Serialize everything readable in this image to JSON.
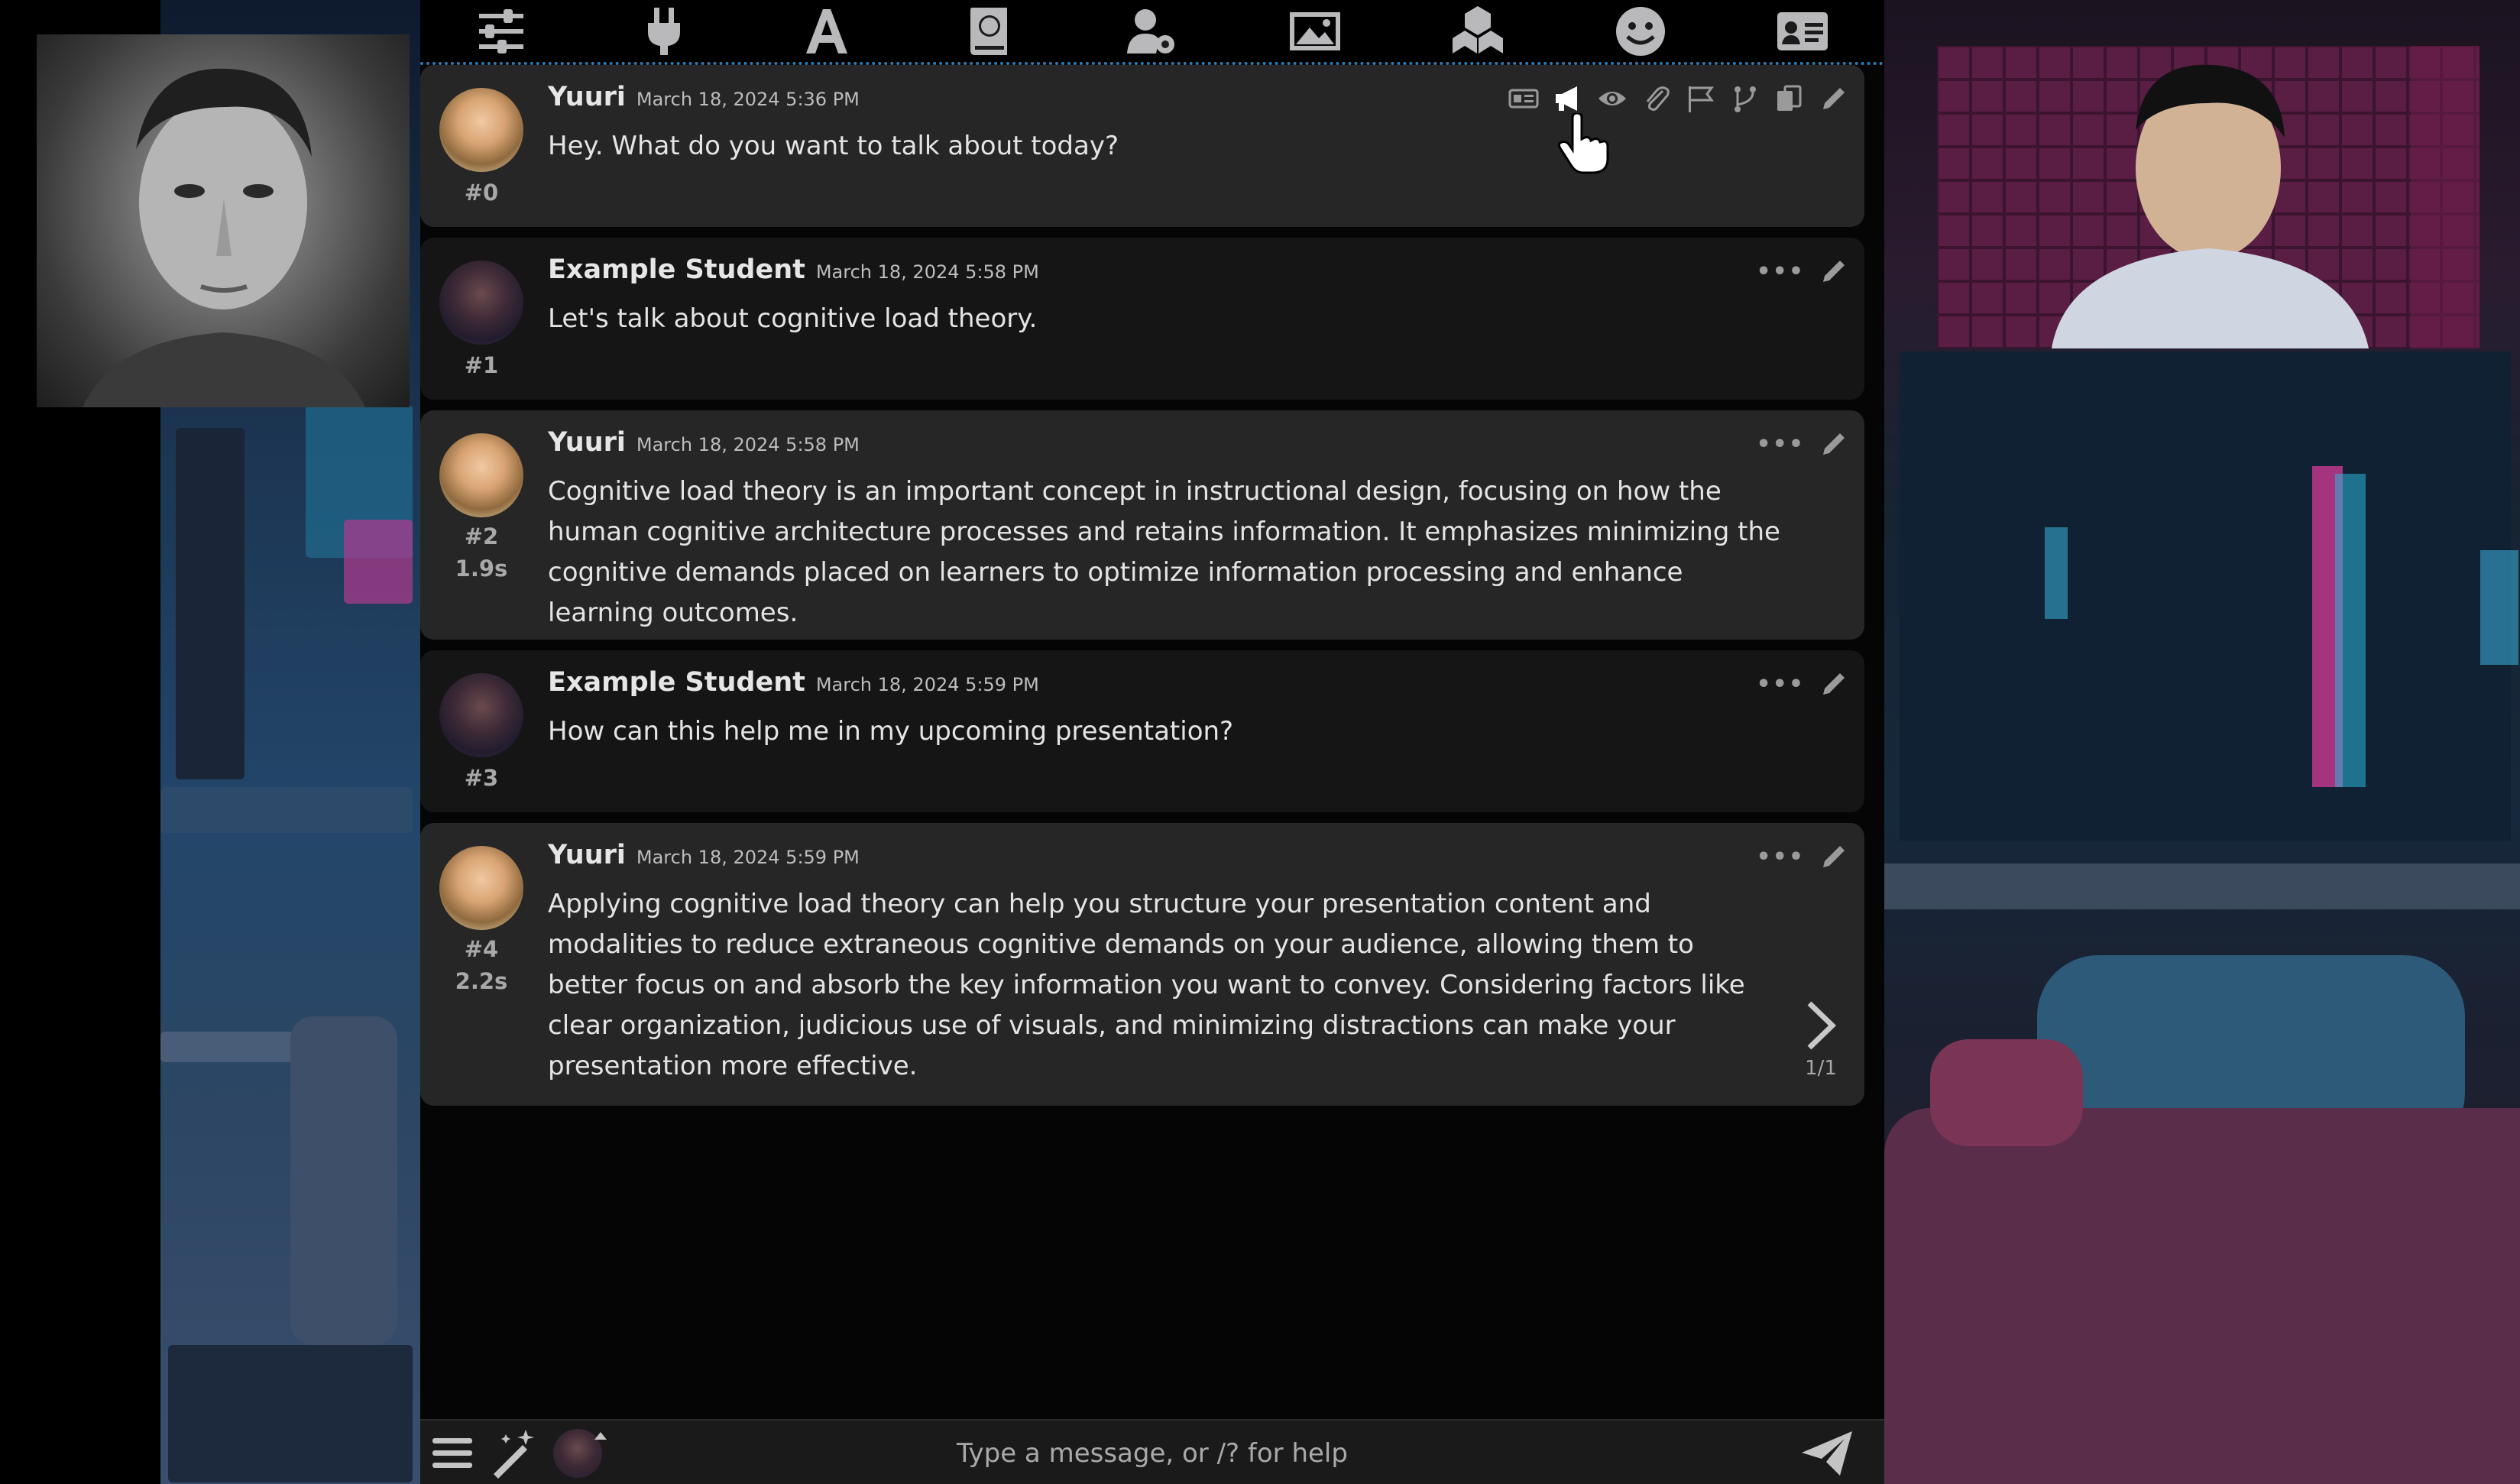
{
  "window": {
    "top_toolbar": [
      {
        "icon": "sliders-icon"
      },
      {
        "icon": "plug-icon"
      },
      {
        "icon": "font-a-icon"
      },
      {
        "icon": "book-globe-icon"
      },
      {
        "icon": "user-gear-icon"
      },
      {
        "icon": "image-icon"
      },
      {
        "icon": "cubes-icon"
      },
      {
        "icon": "smiley-icon"
      },
      {
        "icon": "id-card-icon"
      }
    ]
  },
  "messages": [
    {
      "id": "#0",
      "name": "Yuuri",
      "time": "March 18, 2024 5:36 PM",
      "text": "Hey. What do you want to talk about today?",
      "role": "char"
    },
    {
      "id": "#1",
      "name": "Example Student",
      "time": "March 18, 2024 5:58 PM",
      "text": "Let's talk about cognitive load theory.",
      "role": "user"
    },
    {
      "id": "#2",
      "timer": "1.9s",
      "name": "Yuuri",
      "time": "March 18, 2024 5:58 PM",
      "text": "Cognitive load theory is an important concept in instructional design, focusing on how the human cognitive architecture processes and retains information. It emphasizes minimizing the cognitive demands placed on learners to optimize information processing and enhance learning outcomes.",
      "role": "char"
    },
    {
      "id": "#3",
      "name": "Example Student",
      "time": "March 18, 2024 5:59 PM",
      "text": "How can this help me in my upcoming presentation?",
      "role": "user"
    },
    {
      "id": "#4",
      "timer": "2.2s",
      "name": "Yuuri",
      "time": "March 18, 2024 5:59 PM",
      "text": "Applying cognitive load theory can help you structure your presentation content and modalities to reduce extraneous cognitive demands on your audience, allowing them to better focus on and absorb the key information you want to convey. Considering factors like clear organization, judicious use of visuals, and minimizing distractions can make your presentation more effective.",
      "role": "char",
      "swipe_counter": "1/1"
    }
  ],
  "message_actions": {
    "expanded": [
      "id-card-icon",
      "megaphone-icon",
      "eye-icon",
      "paperclip-icon",
      "flag-icon",
      "branch-icon",
      "copy-icon",
      "pencil-icon"
    ],
    "collapsed": [
      "ellipsis-icon",
      "pencil-icon"
    ],
    "ellipsis": "•••"
  },
  "input": {
    "placeholder": "Type a message, or /? for help"
  },
  "colors": {
    "char_bg": "#262626",
    "user_bg": "#151515",
    "accent_border": "#2f7bb0"
  }
}
